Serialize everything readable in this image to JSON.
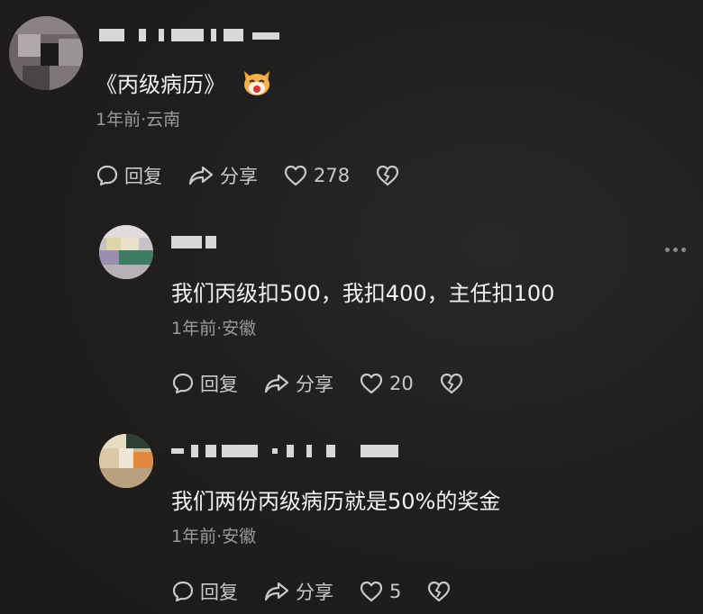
{
  "comments": [
    {
      "text": "《丙级病历》",
      "meta": "1年前·云南",
      "reply_label": "回复",
      "share_label": "分享",
      "likes": "278"
    },
    {
      "text": "我们丙级扣500，我扣400，主任扣100",
      "meta": "1年前·安徽",
      "reply_label": "回复",
      "share_label": "分享",
      "likes": "20"
    },
    {
      "text": "我们两份丙级病历就是50%的奖金",
      "meta": "1年前·安徽",
      "reply_label": "回复",
      "share_label": "分享",
      "likes": "5"
    }
  ],
  "icons": {
    "reply": "speech-bubble-icon",
    "share": "share-arrow-icon",
    "like": "heart-icon",
    "dislike": "broken-heart-icon",
    "emoji": "cat-face-emoji",
    "more": "more-dots-icon"
  }
}
